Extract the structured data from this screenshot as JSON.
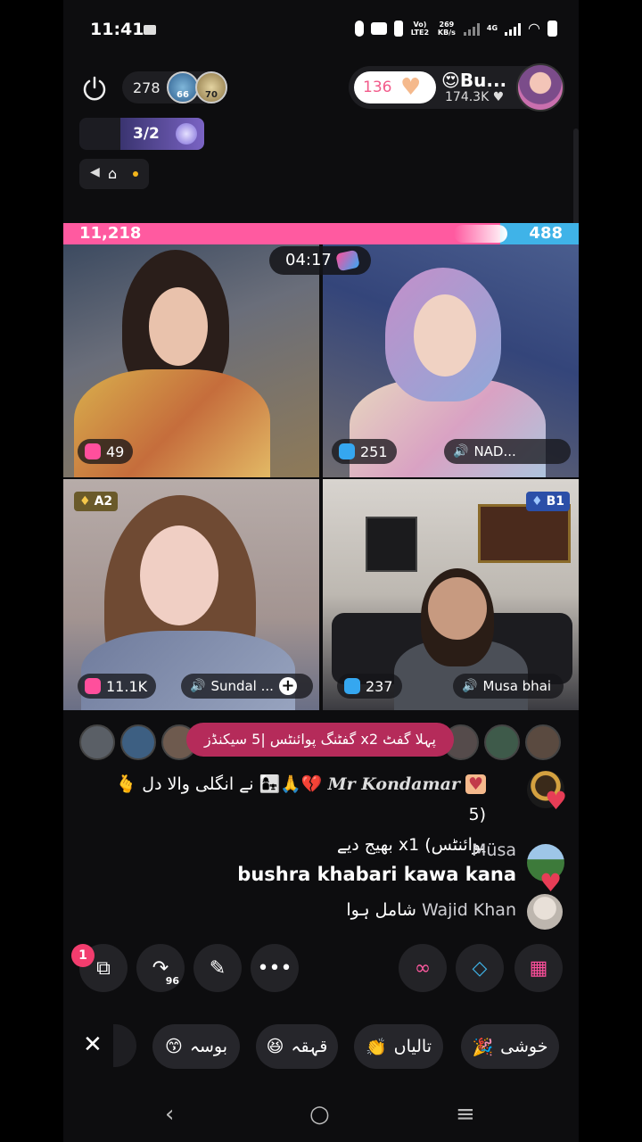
{
  "status_bar": {
    "time": "11:41",
    "network_label": "Vo) LTE2",
    "speed": "269 KB/s",
    "signal": "4G"
  },
  "top": {
    "viewer_count": "278",
    "viewer_badges": [
      "66",
      "70"
    ],
    "likes_count": "136",
    "host_name": "Bu...",
    "host_stats": "174.3K",
    "rank_progress": "3/2"
  },
  "pk": {
    "left_score": "11,218",
    "right_score": "488",
    "timer": "04:17"
  },
  "tiles": [
    {
      "gift_count": "49"
    },
    {
      "gift_count": "251",
      "speaker": "NAD..."
    },
    {
      "gift_count": "11.1K",
      "speaker": "Sundal ...",
      "rank": "A2"
    },
    {
      "gift_count": "237",
      "speaker": "Musa bhai",
      "rank": "B1"
    }
  ],
  "banner": "پہلا گفٹ x2 گفٹنگ پوائنٹس |5 سیکنڈز",
  "chat": [
    {
      "name": "Mr Kondamar",
      "text_line1": "نے انگلی والا دل",
      "count": "(5",
      "text_line2": "پوائنٹس) x1 بھیج دیے"
    },
    {
      "name": "Müsa",
      "text": "bushra khabari kawa kana"
    },
    {
      "name": "Wajid Khan",
      "text": "شامل ہوا"
    }
  ],
  "actions": {
    "notification_count": "1",
    "share_count": "96"
  },
  "quick_reactions": [
    "خوشی",
    "تالیاں",
    "قہقہ",
    "بوسہ"
  ],
  "colors": {
    "pk_pink": "#ff5aa0",
    "pk_blue": "#3fb3e8",
    "banner": "#b52b5a",
    "chip_bg": "#26262b"
  }
}
